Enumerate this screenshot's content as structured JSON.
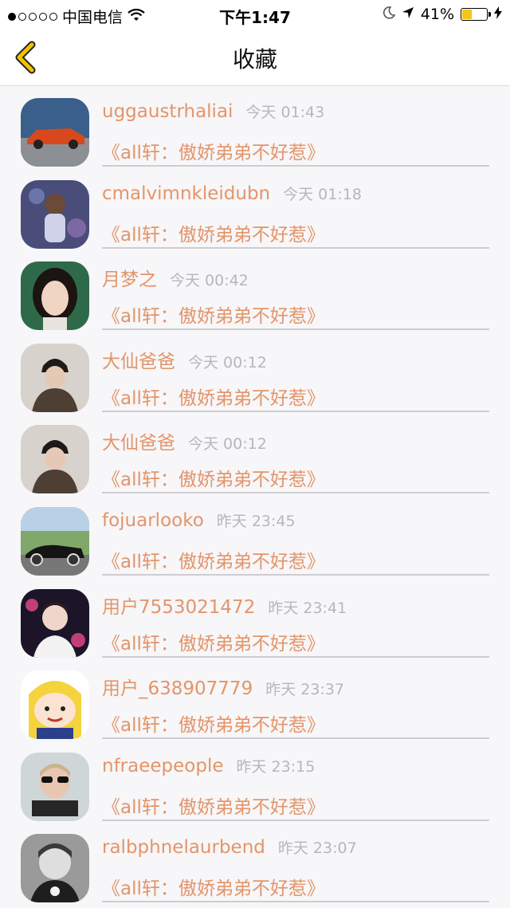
{
  "status_bar": {
    "carrier": "中国电信",
    "time": "下午1:47",
    "battery": "41%",
    "battery_level": 0.41
  },
  "nav": {
    "title": "收藏"
  },
  "items": [
    {
      "name": "uggaustrhaliai",
      "time": "今天 01:43",
      "book": "《all轩：傲娇弟弟不好惹》"
    },
    {
      "name": "cmalvimnkleidubn",
      "time": "今天 01:18",
      "book": "《all轩：傲娇弟弟不好惹》"
    },
    {
      "name": "月梦之",
      "time": "今天 00:42",
      "book": "《all轩：傲娇弟弟不好惹》"
    },
    {
      "name": "大仙爸爸",
      "time": "今天 00:12",
      "book": "《all轩：傲娇弟弟不好惹》"
    },
    {
      "name": "大仙爸爸",
      "time": "今天 00:12",
      "book": "《all轩：傲娇弟弟不好惹》"
    },
    {
      "name": "fojuarlooko",
      "time": "昨天 23:45",
      "book": "《all轩：傲娇弟弟不好惹》"
    },
    {
      "name": "用户7553021472",
      "time": "昨天 23:41",
      "book": "《all轩：傲娇弟弟不好惹》"
    },
    {
      "name": "用户_638907779",
      "time": "昨天 23:37",
      "book": "《all轩：傲娇弟弟不好惹》"
    },
    {
      "name": "nfraeepeople",
      "time": "昨天 23:15",
      "book": "《all轩：傲娇弟弟不好惹》"
    },
    {
      "name": "ralbphnelaurbend",
      "time": "昨天 23:07",
      "book": "《all轩：傲娇弟弟不好惹》"
    }
  ],
  "colors": {
    "accent": "#e3956a",
    "time": "#b8b6ba",
    "back": "#f2c200"
  }
}
